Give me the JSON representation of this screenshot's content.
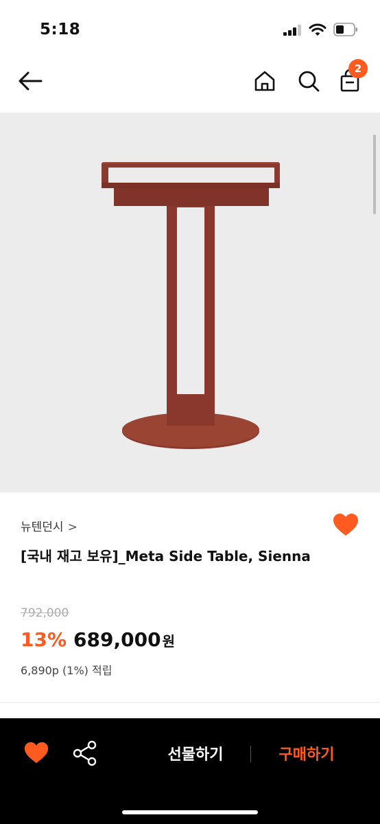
{
  "status_bar": {
    "time": "5:18"
  },
  "header": {
    "cart_count": "2"
  },
  "product": {
    "brand": "뉴텐던시",
    "brand_chevron": ">",
    "title": "[국내 재고 보유]_Meta Side Table, Sienna",
    "original_price": "792,000",
    "discount": "13%",
    "price": "689,000",
    "currency": "원",
    "points": "6,890p (1%) 적립"
  },
  "bottom_bar": {
    "gift_label": "선물하기",
    "buy_label": "구매하기"
  },
  "colors": {
    "accent": "#ff5a1f",
    "image_bg": "#ececec",
    "product_color": "#8b3a2f",
    "bottom_bar": "#000000"
  }
}
